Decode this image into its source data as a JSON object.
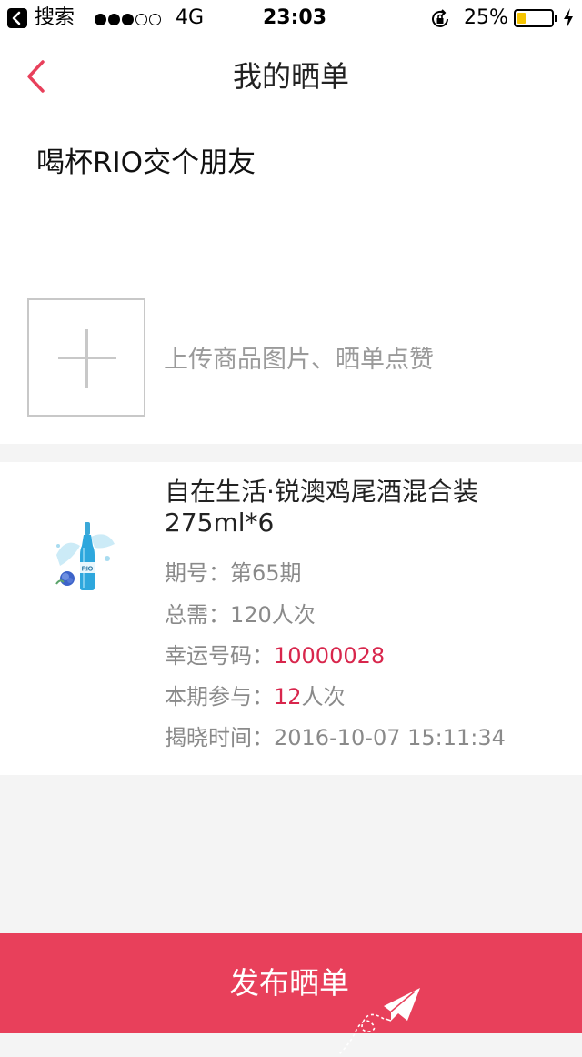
{
  "status_bar": {
    "back_app": "搜索",
    "signal_dots": [
      true,
      true,
      true,
      false,
      false
    ],
    "network": "4G",
    "time": "23:03",
    "battery_pct": "25%",
    "battery_level": 0.25
  },
  "nav": {
    "title": "我的晒单"
  },
  "compose": {
    "text": "喝杯RIO交个朋友",
    "upload_hint": "上传商品图片、晒单点赞"
  },
  "product": {
    "name": "自在生活·锐澳鸡尾酒混合装275ml*6",
    "rows": [
      {
        "label": "期号：",
        "value": "第65期",
        "suffix": "",
        "highlight": false
      },
      {
        "label": "总需：",
        "value": "120人次",
        "suffix": "",
        "highlight": false
      },
      {
        "label": "幸运号码：",
        "value": "10000028",
        "suffix": "",
        "highlight": true
      },
      {
        "label": "本期参与：",
        "value": "12",
        "suffix": "人次",
        "highlight": true
      },
      {
        "label": "揭晓时间：",
        "value": "2016-10-07 15:11:34",
        "suffix": "",
        "highlight": false
      }
    ],
    "bottle_label": "RIO"
  },
  "footer": {
    "publish_label": "发布晒单"
  },
  "colors": {
    "accent": "#e8405b",
    "highlight_text": "#d8264c",
    "battery": "#f5c400"
  }
}
